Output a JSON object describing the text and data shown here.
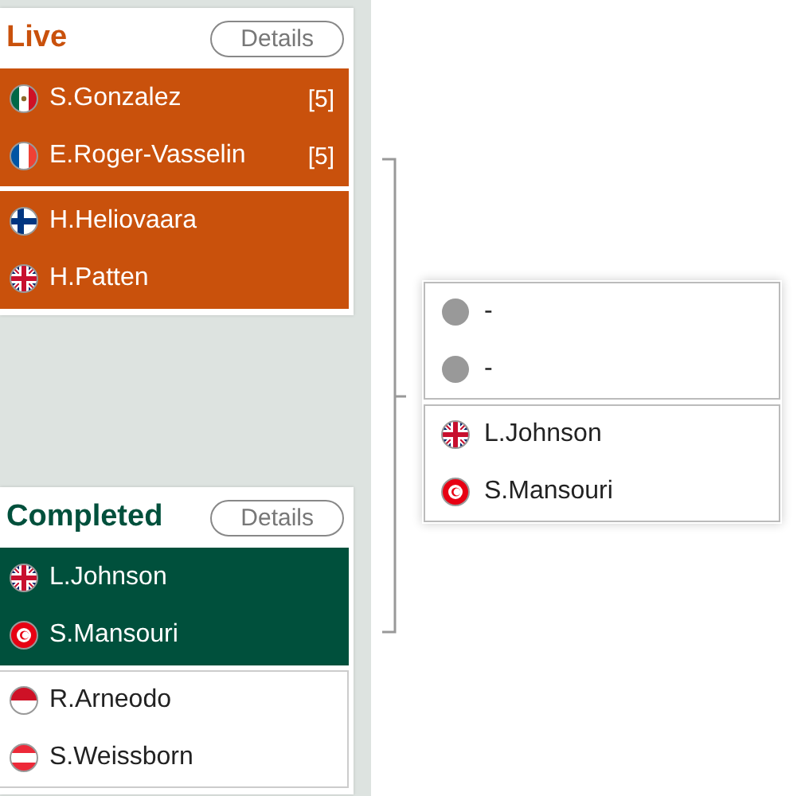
{
  "matches": [
    {
      "kind": "live",
      "title": "Live",
      "button": "Details",
      "teams": [
        {
          "highlighted": true,
          "players": [
            {
              "name": "S.Gonzalez",
              "kind": "mx",
              "seed": "[5]"
            },
            {
              "name": "E.Roger-Vasselin",
              "kind": "fr",
              "seed": "[5]"
            }
          ]
        },
        {
          "highlighted": true,
          "players": [
            {
              "name": "H.Heliovaara",
              "kind": "fi"
            },
            {
              "name": "H.Patten",
              "kind": "gb"
            }
          ]
        }
      ]
    },
    {
      "kind": "completed",
      "title": "Completed",
      "button": "Details",
      "teams": [
        {
          "highlighted": true,
          "players": [
            {
              "name": "L.Johnson",
              "kind": "gb"
            },
            {
              "name": "S.Mansouri",
              "kind": "tn"
            }
          ]
        },
        {
          "highlighted": false,
          "players": [
            {
              "name": "R.Arneodo",
              "kind": "mc"
            },
            {
              "name": "S.Weissborn",
              "kind": "at"
            }
          ]
        }
      ]
    }
  ],
  "next_match": {
    "teams": [
      {
        "highlighted": false,
        "players": [
          {
            "name": "-",
            "kind": "none"
          },
          {
            "name": "-",
            "kind": "none"
          }
        ]
      },
      {
        "highlighted": false,
        "players": [
          {
            "name": "L.Johnson",
            "kind": "gb"
          },
          {
            "name": "S.Mansouri",
            "kind": "tn"
          }
        ]
      }
    ]
  }
}
